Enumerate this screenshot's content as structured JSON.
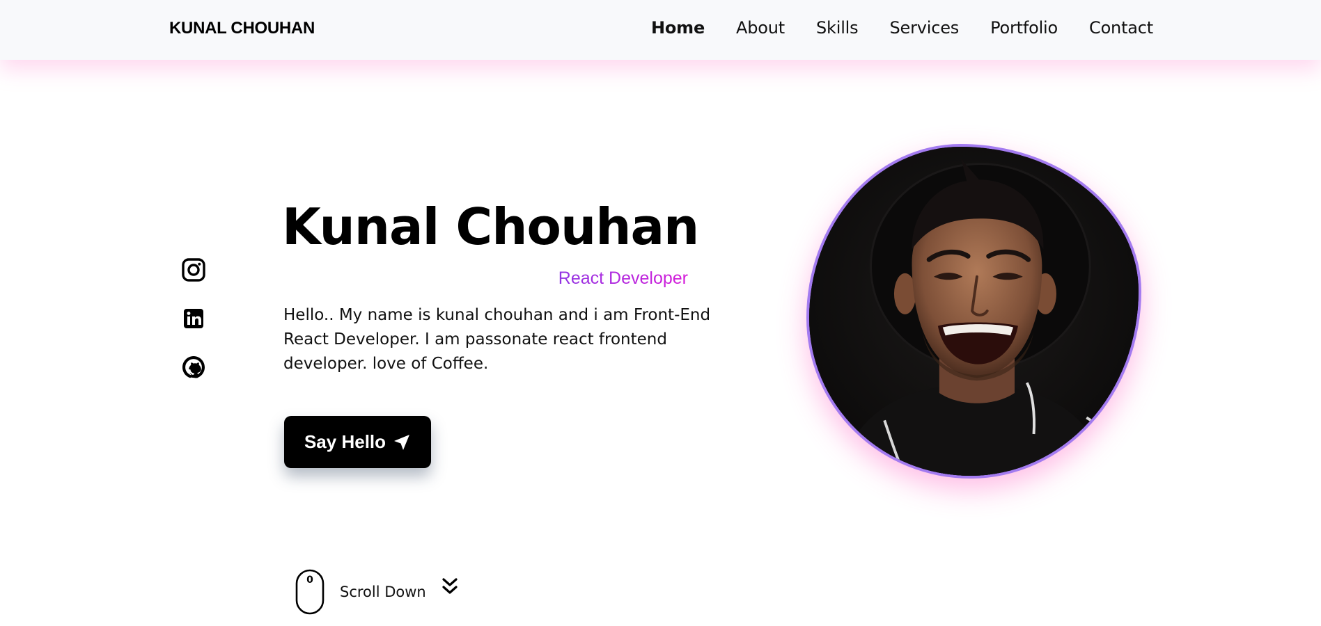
{
  "header": {
    "logo": "KUNAL CHOUHAN",
    "nav": [
      {
        "label": "Home",
        "active": true
      },
      {
        "label": "About",
        "active": false
      },
      {
        "label": "Skills",
        "active": false
      },
      {
        "label": "Services",
        "active": false
      },
      {
        "label": "Portfolio",
        "active": false
      },
      {
        "label": "Contact",
        "active": false
      }
    ]
  },
  "socials": [
    {
      "icon": "instagram-icon"
    },
    {
      "icon": "linkedin-icon"
    },
    {
      "icon": "github-icon"
    }
  ],
  "hero": {
    "name": "Kunal Chouhan",
    "subtitle": "React Developer",
    "description": "Hello.. My name is kunal chouhan and i am Front-End React Developer. I am passonate react frontend developer. love of Coffee.",
    "cta_label": "Say Hello",
    "cta_icon": "send-icon"
  },
  "scroll": {
    "label": "Scroll Down",
    "mouse_label": "0"
  },
  "colors": {
    "accent_purple": "#a37bf0",
    "subtitle_gradient_start": "#7a3ce6",
    "subtitle_gradient_end": "#d61bd9",
    "header_shadow_pink": "#ff78c8",
    "button_bg": "#000000",
    "header_bg": "#f8f9fb"
  }
}
